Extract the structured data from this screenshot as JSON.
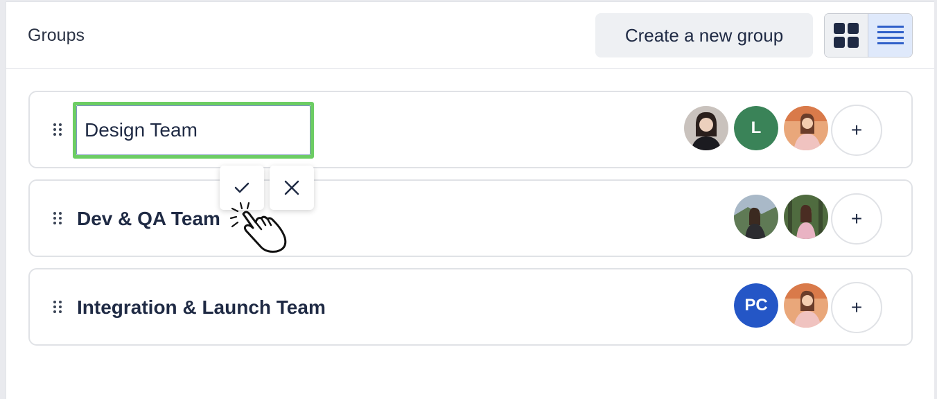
{
  "header": {
    "title": "Groups",
    "create_label": "Create a new group"
  },
  "view_toggle": {
    "active": "list"
  },
  "groups": [
    {
      "name": "Design Team",
      "editing": true,
      "input_value": "Design Team",
      "members": [
        {
          "type": "photo",
          "icon": "photo-avatar"
        },
        {
          "type": "initials",
          "initials": "L",
          "color": "#3a8358"
        },
        {
          "type": "photo",
          "icon": "photo-avatar"
        }
      ]
    },
    {
      "name": "Dev & QA Team",
      "members": [
        {
          "type": "photo",
          "icon": "photo-avatar"
        },
        {
          "type": "photo",
          "icon": "photo-avatar"
        }
      ]
    },
    {
      "name": "Integration & Launch Team",
      "members": [
        {
          "type": "initials",
          "initials": "PC",
          "color": "#2456c6"
        },
        {
          "type": "photo",
          "icon": "photo-avatar"
        }
      ]
    }
  ],
  "add_member_symbol": "+",
  "colors": {
    "input_focus_border": "#6ccd63",
    "list_toggle_active_bg": "#dfe9fb",
    "list_icon": "#2f5fc9",
    "grid_icon": "#1f2a44"
  }
}
